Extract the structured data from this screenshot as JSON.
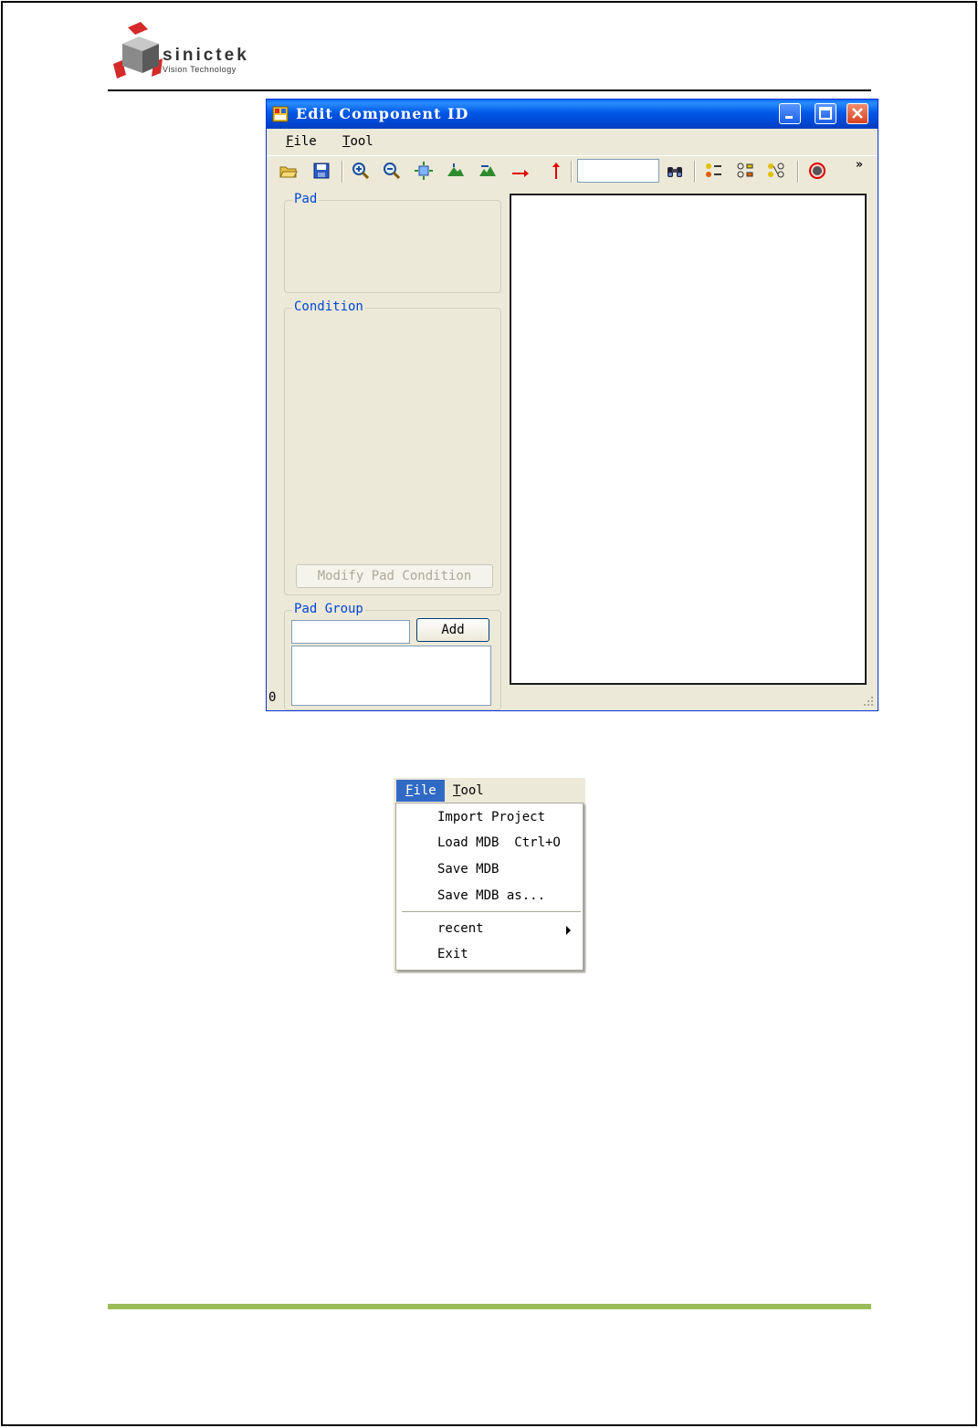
{
  "header": {
    "logo_name": "sinictek",
    "logo_subtitle": "Vision Technology",
    "accent": "#d42a2a",
    "footer_rule_color": "#9bbb59"
  },
  "window": {
    "title": "Edit Component ID",
    "title_icon": "app-window-icon",
    "menu": [
      {
        "label": "File",
        "mnemonic": "F"
      },
      {
        "label": "Tool",
        "mnemonic": "T"
      }
    ],
    "toolbar": {
      "icons": [
        "open-folder-icon",
        "save-disk-icon",
        "zoom-in-icon",
        "zoom-out-icon",
        "fit-view-icon",
        "mountain-up-icon",
        "mountain-flip-icon",
        "arrow-right-icon",
        "arrow-up-icon",
        "binoculars-icon",
        "pads-select-icon",
        "pads-frame-icon",
        "pads-link-icon",
        "stop-record-icon"
      ],
      "search_value": "",
      "overflow": "»"
    },
    "pad_group_box": {
      "label": "Pad"
    },
    "condition_box": {
      "label": "Condition",
      "modify_button": "Modify Pad Condition"
    },
    "padgroup_box": {
      "label": "Pad Group",
      "input_value": "",
      "add_button": "Add"
    },
    "status": "0"
  },
  "file_menu": {
    "bar": [
      {
        "label": "File",
        "mnemonic": "F"
      },
      {
        "label": "Tool",
        "mnemonic": "T"
      }
    ],
    "items": [
      {
        "label": "Import Project"
      },
      {
        "label": "Load MDB  Ctrl+O"
      },
      {
        "label": "Save MDB"
      },
      {
        "label": "Save MDB as..."
      },
      {
        "label": "recent",
        "submenu": true
      },
      {
        "label": "Exit"
      }
    ]
  }
}
